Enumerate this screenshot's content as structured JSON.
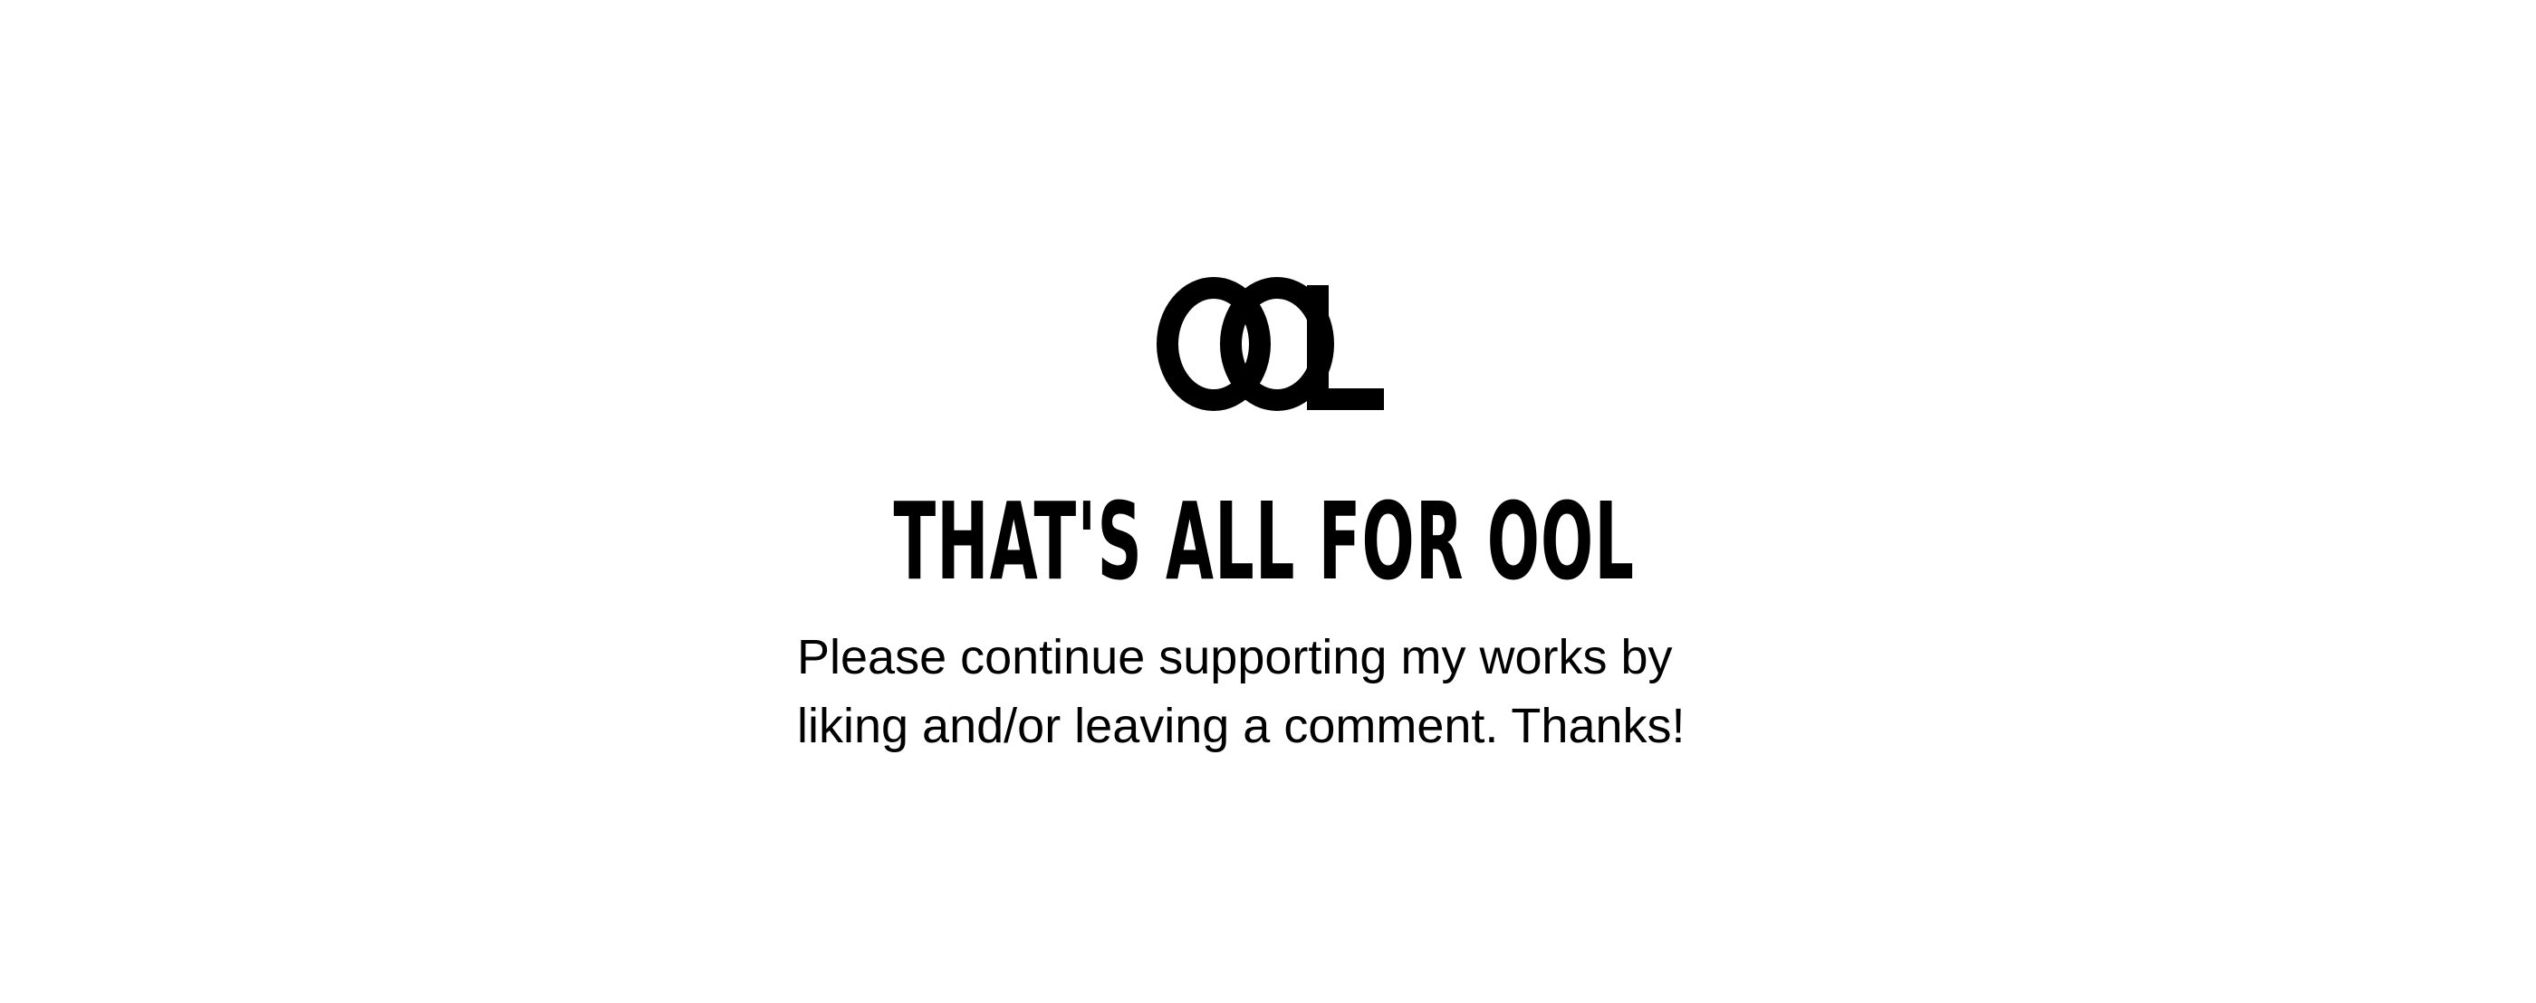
{
  "logo": {
    "icon": "ool-monogram-icon",
    "text": "OOL",
    "color": "#000000"
  },
  "title": "THAT'S ALL FOR OOL",
  "message": {
    "line1": "Please continue supporting my works by",
    "line2": "liking and/or leaving a comment. Thanks!"
  },
  "colors": {
    "background": "#ffffff",
    "text": "#000000"
  }
}
